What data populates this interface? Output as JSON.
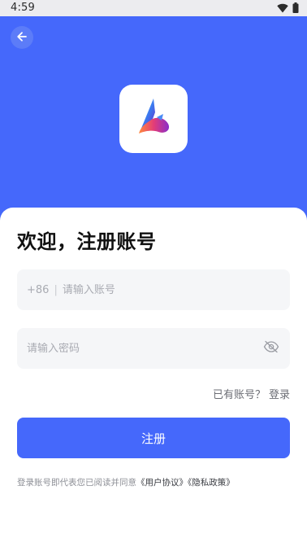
{
  "status_bar": {
    "time": "4:59",
    "icons": [
      "wifi-icon",
      "battery-icon"
    ]
  },
  "header": {
    "back_icon": "arrow-left-icon",
    "logo_icon": "app-logo-icon",
    "background_color": "#4568fb"
  },
  "form": {
    "title": "欢迎，注册账号",
    "phone": {
      "country_code": "+86",
      "separator": "|",
      "placeholder": "请输入账号",
      "value": ""
    },
    "password": {
      "placeholder": "请输入密码",
      "value": "",
      "toggle_icon": "eye-off-icon"
    },
    "login_prompt": "已有账号？",
    "login_link": "登录",
    "register_button": "注册",
    "agreement": {
      "prefix": "登录账号即代表您已阅读并同意",
      "user_agreement": "《用户协议》",
      "privacy_policy": "《隐私政策》"
    }
  },
  "colors": {
    "primary": "#4568fb",
    "field_bg": "#f5f6f8",
    "placeholder": "#a9abb2"
  }
}
